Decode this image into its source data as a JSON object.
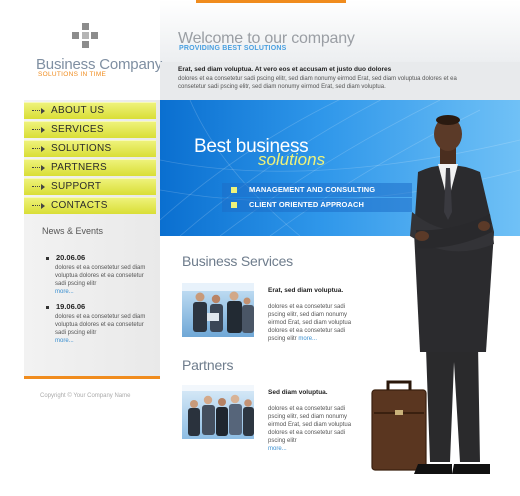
{
  "brand": {
    "name": "Business Company",
    "tagline": "SOLUTIONS IN TIME"
  },
  "header": {
    "welcome": "Welcome to our company",
    "subtitle": "PROVIDING BEST SOLUTIONS",
    "intro_bold": "Erat, sed diam voluptua. At vero eos et accusam et justo duo dolores",
    "intro_text": "dolores et ea consetetur sadi pscing elitr, sed diam nonumy eirmod Erat, sed diam voluptua dolores et ea consetetur sadi pscing elitr, sed diam nonumy eirmod Erat, sed diam voluptua."
  },
  "nav": {
    "items": [
      "ABOUT US",
      "SERVICES",
      "SOLUTIONS",
      "PARTNERS",
      "SUPPORT",
      "CONTACTS"
    ]
  },
  "news": {
    "title": "News & Events",
    "items": [
      {
        "date": "20.06.06",
        "text": "dolores et ea consetetur sed diam voluptua dolores et ea consetetur sadi pscing elitr",
        "more": "more..."
      },
      {
        "date": "19.06.06",
        "text": "dolores et ea consetetur sed diam voluptua dolores et ea consetetur sadi pscing elitr",
        "more": "more..."
      }
    ]
  },
  "banner": {
    "line1": "Best business",
    "line2": "solutions",
    "features": [
      "MANAGEMENT AND CONSULTING",
      "CLIENT ORIENTED APPROACH"
    ]
  },
  "services": {
    "title": "Business Services",
    "bold": "Erat, sed diam voluptua.",
    "text": "dolores et ea consetetur sadi pscing elitr, sed diam nonumy eirmod Erat, sed diam voluptua dolores et ea consetetur sadi pscing elitr",
    "more": "more..."
  },
  "partners": {
    "title": "Partners",
    "bold": "Sed diam voluptua.",
    "text": "dolores et ea consetetur sadi pscing elitr, sed diam nonumy eirmod Erat, sed diam voluptua dolores et ea consetetur sadi pscing elitr",
    "more": "more..."
  },
  "footer": {
    "copyright": "Copyright © Your Company Name"
  },
  "colors": {
    "accent": "#f08c1e",
    "nav": "#d9de36",
    "banner": "#2f97ea",
    "link": "#3a8fd0"
  }
}
